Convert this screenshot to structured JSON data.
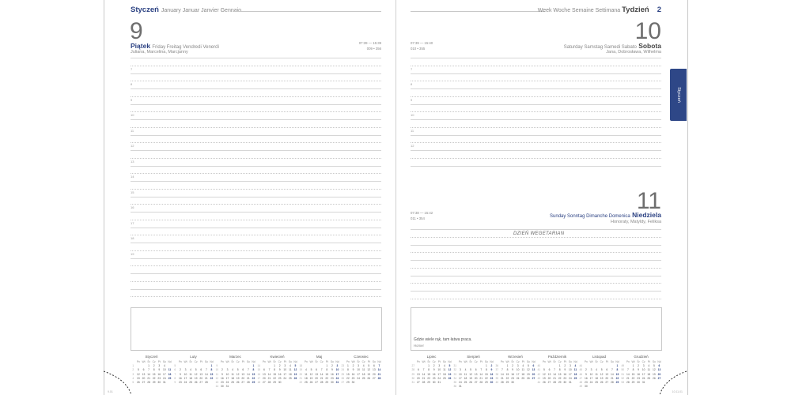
{
  "left": {
    "header_month": "Styczeń",
    "header_langs": "January Januar Janvier Gennaio",
    "day_number": "9",
    "day_name": "Piątek",
    "day_langs": "Friday Freitag Vendredi Venerdì",
    "namedays": "Juliana, Marcelina, Marcjanny",
    "sun_times": "07:39 — 15:39",
    "day_of_year": "009 • 356",
    "hours": [
      "7",
      "8",
      "9",
      "10",
      "11",
      "12",
      "13",
      "14",
      "15",
      "16",
      "17",
      "18",
      "19"
    ],
    "footer": "9.01"
  },
  "right": {
    "header_langs": "Week Woche Semaine Settimana",
    "header_week": "Tydzień",
    "week_number": "2",
    "sat": {
      "day_number": "10",
      "day_name": "Sobota",
      "day_langs": "Saturday Samstag Samedi Sabato",
      "namedays": "Jana, Dobrosława, Wilhelma",
      "sun_times": "07:39 — 15:40",
      "day_of_year": "010 • 355",
      "hours": [
        "7",
        "8",
        "9",
        "10",
        "11",
        "12"
      ]
    },
    "sun": {
      "day_number": "11",
      "day_name": "Niedziela",
      "day_langs": "Sunday Sonntag Dimanche Domenica",
      "namedays": "Honoraty, Matyldy, Feliksa",
      "sun_times": "07:38 — 15:42",
      "day_of_year": "011 • 354",
      "special": "DZIEŃ WEGETARIAN"
    },
    "quote": "Gdzie wiele rąk, tam łatwa praca.",
    "quote_author": "Homer",
    "tab_label": "Styczeń",
    "footer": "10.11.01"
  },
  "weekday_headers": [
    "Pn",
    "Wt",
    "Śr",
    "Cz",
    "Pt",
    "So",
    "Nd"
  ],
  "calendars_left": [
    {
      "name": "Styczeń",
      "weeks": [
        [
          "1",
          "",
          "",
          "1",
          "2",
          "3",
          "4"
        ],
        [
          "2",
          "5",
          "6",
          "7",
          "8",
          "9",
          "10",
          "11"
        ],
        [
          "3",
          "12",
          "13",
          "14",
          "15",
          "16",
          "17",
          "18"
        ],
        [
          "4",
          "19",
          "20",
          "21",
          "22",
          "23",
          "24",
          "25"
        ],
        [
          "5",
          "26",
          "27",
          "28",
          "29",
          "30",
          "31",
          ""
        ]
      ]
    },
    {
      "name": "Luty",
      "weeks": [
        [
          "5",
          "",
          "",
          "",
          "",
          "",
          "",
          "1"
        ],
        [
          "6",
          "2",
          "3",
          "4",
          "5",
          "6",
          "7",
          "8"
        ],
        [
          "7",
          "9",
          "10",
          "11",
          "12",
          "13",
          "14",
          "15"
        ],
        [
          "8",
          "16",
          "17",
          "18",
          "19",
          "20",
          "21",
          "22"
        ],
        [
          "9",
          "23",
          "24",
          "25",
          "26",
          "27",
          "28",
          ""
        ]
      ]
    },
    {
      "name": "Marzec",
      "weeks": [
        [
          "9",
          "",
          "",
          "",
          "",
          "",
          "",
          "1"
        ],
        [
          "10",
          "2",
          "3",
          "4",
          "5",
          "6",
          "7",
          "8"
        ],
        [
          "11",
          "9",
          "10",
          "11",
          "12",
          "13",
          "14",
          "15"
        ],
        [
          "12",
          "16",
          "17",
          "18",
          "19",
          "20",
          "21",
          "22"
        ],
        [
          "13",
          "23",
          "24",
          "25",
          "26",
          "27",
          "28",
          "29"
        ],
        [
          "14",
          "30",
          "31",
          "",
          "",
          "",
          "",
          ""
        ]
      ]
    },
    {
      "name": "Kwiecień",
      "weeks": [
        [
          "14",
          "",
          "",
          "1",
          "2",
          "3",
          "4",
          "5"
        ],
        [
          "15",
          "6",
          "7",
          "8",
          "9",
          "10",
          "11",
          "12"
        ],
        [
          "16",
          "13",
          "14",
          "15",
          "16",
          "17",
          "18",
          "19"
        ],
        [
          "17",
          "20",
          "21",
          "22",
          "23",
          "24",
          "25",
          "26"
        ],
        [
          "18",
          "27",
          "28",
          "29",
          "30",
          "",
          "",
          ""
        ]
      ]
    },
    {
      "name": "Maj",
      "weeks": [
        [
          "18",
          "",
          "",
          "",
          "",
          "1",
          "2",
          "3"
        ],
        [
          "19",
          "4",
          "5",
          "6",
          "7",
          "8",
          "9",
          "10"
        ],
        [
          "20",
          "11",
          "12",
          "13",
          "14",
          "15",
          "16",
          "17"
        ],
        [
          "21",
          "18",
          "19",
          "20",
          "21",
          "22",
          "23",
          "24"
        ],
        [
          "22",
          "25",
          "26",
          "27",
          "28",
          "29",
          "30",
          "31"
        ]
      ]
    },
    {
      "name": "Czerwiec",
      "weeks": [
        [
          "23",
          "1",
          "2",
          "3",
          "4",
          "5",
          "6",
          "7"
        ],
        [
          "24",
          "8",
          "9",
          "10",
          "11",
          "12",
          "13",
          "14"
        ],
        [
          "25",
          "15",
          "16",
          "17",
          "18",
          "19",
          "20",
          "21"
        ],
        [
          "26",
          "22",
          "23",
          "24",
          "25",
          "26",
          "27",
          "28"
        ],
        [
          "27",
          "29",
          "30",
          "",
          "",
          "",
          "",
          ""
        ]
      ]
    }
  ],
  "calendars_right": [
    {
      "name": "Lipiec",
      "weeks": [
        [
          "27",
          "",
          "",
          "1",
          "2",
          "3",
          "4",
          "5"
        ],
        [
          "28",
          "6",
          "7",
          "8",
          "9",
          "10",
          "11",
          "12"
        ],
        [
          "29",
          "13",
          "14",
          "15",
          "16",
          "17",
          "18",
          "19"
        ],
        [
          "30",
          "20",
          "21",
          "22",
          "23",
          "24",
          "25",
          "26"
        ],
        [
          "31",
          "27",
          "28",
          "29",
          "30",
          "31",
          "",
          ""
        ]
      ]
    },
    {
      "name": "Sierpień",
      "weeks": [
        [
          "31",
          "",
          "",
          "",
          "",
          "",
          "1",
          "2"
        ],
        [
          "32",
          "3",
          "4",
          "5",
          "6",
          "7",
          "8",
          "9"
        ],
        [
          "33",
          "10",
          "11",
          "12",
          "13",
          "14",
          "15",
          "16"
        ],
        [
          "34",
          "17",
          "18",
          "19",
          "20",
          "21",
          "22",
          "23"
        ],
        [
          "35",
          "24",
          "25",
          "26",
          "27",
          "28",
          "29",
          "30"
        ],
        [
          "36",
          "31",
          "",
          "",
          "",
          "",
          "",
          ""
        ]
      ]
    },
    {
      "name": "Wrzesień",
      "weeks": [
        [
          "36",
          "",
          "1",
          "2",
          "3",
          "4",
          "5",
          "6"
        ],
        [
          "37",
          "7",
          "8",
          "9",
          "10",
          "11",
          "12",
          "13"
        ],
        [
          "38",
          "14",
          "15",
          "16",
          "17",
          "18",
          "19",
          "20"
        ],
        [
          "39",
          "21",
          "22",
          "23",
          "24",
          "25",
          "26",
          "27"
        ],
        [
          "40",
          "28",
          "29",
          "30",
          "",
          "",
          "",
          ""
        ]
      ]
    },
    {
      "name": "Październik",
      "weeks": [
        [
          "40",
          "",
          "",
          "",
          "1",
          "2",
          "3",
          "4"
        ],
        [
          "41",
          "5",
          "6",
          "7",
          "8",
          "9",
          "10",
          "11"
        ],
        [
          "42",
          "12",
          "13",
          "14",
          "15",
          "16",
          "17",
          "18"
        ],
        [
          "43",
          "19",
          "20",
          "21",
          "22",
          "23",
          "24",
          "25"
        ],
        [
          "44",
          "26",
          "27",
          "28",
          "29",
          "30",
          "31",
          ""
        ]
      ]
    },
    {
      "name": "Listopad",
      "weeks": [
        [
          "44",
          "",
          "",
          "",
          "",
          "",
          "",
          "1"
        ],
        [
          "45",
          "2",
          "3",
          "4",
          "5",
          "6",
          "7",
          "8"
        ],
        [
          "46",
          "9",
          "10",
          "11",
          "12",
          "13",
          "14",
          "15"
        ],
        [
          "47",
          "16",
          "17",
          "18",
          "19",
          "20",
          "21",
          "22"
        ],
        [
          "48",
          "23",
          "24",
          "25",
          "26",
          "27",
          "28",
          "29"
        ],
        [
          "49",
          "30",
          "",
          "",
          "",
          "",
          "",
          ""
        ]
      ]
    },
    {
      "name": "Grudzień",
      "weeks": [
        [
          "49",
          "",
          "1",
          "2",
          "3",
          "4",
          "5",
          "6"
        ],
        [
          "50",
          "7",
          "8",
          "9",
          "10",
          "11",
          "12",
          "13"
        ],
        [
          "51",
          "14",
          "15",
          "16",
          "17",
          "18",
          "19",
          "20"
        ],
        [
          "52",
          "21",
          "22",
          "23",
          "24",
          "25",
          "26",
          "27"
        ],
        [
          "53",
          "28",
          "29",
          "30",
          "31",
          "",
          "",
          ""
        ]
      ]
    }
  ]
}
